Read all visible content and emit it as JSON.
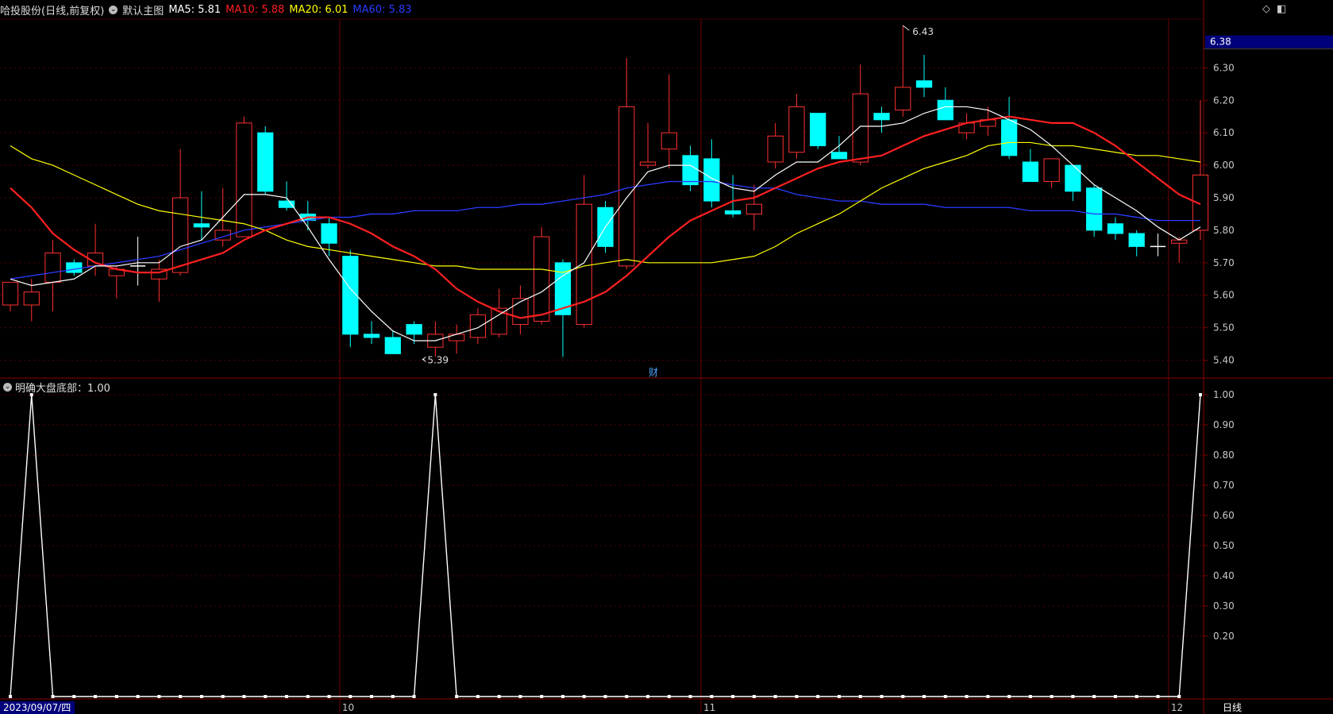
{
  "header": {
    "stock": "哈投股份",
    "mode": "(日线,前复权)",
    "template_label": "默认主图",
    "ma": [
      {
        "label": "MA5: 5.81",
        "color": "#ffffff"
      },
      {
        "label": "MA10: 5.88",
        "color": "#ff2020"
      },
      {
        "label": "MA20: 6.01",
        "color": "#ffff00"
      },
      {
        "label": "MA60: 5.83",
        "color": "#2a3bff"
      }
    ]
  },
  "sub": {
    "label": "明确大盘底部：1.00"
  },
  "price_tag": "6.38",
  "max_label": "6.43",
  "min_label": "5.39",
  "fin_marker": "财",
  "period_label": "日线",
  "date_label": "2023/09/07/四",
  "month_labels": [
    "10",
    "11",
    "12"
  ],
  "chart_data": {
    "type": "candlestick",
    "y_range": [
      5.35,
      6.45
    ],
    "y_ticks": [
      "6.30",
      "6.20",
      "6.10",
      "6.00",
      "5.90",
      "5.80",
      "5.70",
      "5.60",
      "5.50",
      "5.40"
    ],
    "sub_ticks": [
      "1.00",
      "0.90",
      "0.80",
      "0.70",
      "0.60",
      "0.50",
      "0.40",
      "0.30",
      "0.20"
    ],
    "sub_range": [
      0,
      1
    ],
    "month_starts": [
      16,
      33,
      55
    ],
    "candles": [
      {
        "o": 5.57,
        "h": 5.62,
        "l": 5.55,
        "c": 5.64,
        "d": "up"
      },
      {
        "o": 5.57,
        "h": 5.65,
        "l": 5.52,
        "c": 5.61,
        "d": "up"
      },
      {
        "o": 5.64,
        "h": 5.77,
        "l": 5.55,
        "c": 5.73,
        "d": "up"
      },
      {
        "o": 5.7,
        "h": 5.71,
        "l": 5.66,
        "c": 5.67,
        "d": "down"
      },
      {
        "o": 5.69,
        "h": 5.82,
        "l": 5.66,
        "c": 5.73,
        "d": "up"
      },
      {
        "o": 5.66,
        "h": 5.69,
        "l": 5.59,
        "c": 5.68,
        "d": "up"
      },
      {
        "o": 5.69,
        "h": 5.78,
        "l": 5.63,
        "c": 5.69,
        "d": "flat"
      },
      {
        "o": 5.65,
        "h": 5.71,
        "l": 5.58,
        "c": 5.68,
        "d": "up"
      },
      {
        "o": 5.67,
        "h": 6.05,
        "l": 5.66,
        "c": 5.9,
        "d": "up"
      },
      {
        "o": 5.82,
        "h": 5.92,
        "l": 5.77,
        "c": 5.81,
        "d": "down"
      },
      {
        "o": 5.77,
        "h": 5.93,
        "l": 5.75,
        "c": 5.8,
        "d": "up"
      },
      {
        "o": 5.78,
        "h": 6.15,
        "l": 5.78,
        "c": 6.13,
        "d": "up"
      },
      {
        "o": 6.1,
        "h": 6.12,
        "l": 5.91,
        "c": 5.92,
        "d": "down"
      },
      {
        "o": 5.89,
        "h": 5.95,
        "l": 5.86,
        "c": 5.87,
        "d": "down"
      },
      {
        "o": 5.85,
        "h": 5.89,
        "l": 5.8,
        "c": 5.83,
        "d": "down"
      },
      {
        "o": 5.82,
        "h": 5.84,
        "l": 5.72,
        "c": 5.76,
        "d": "down"
      },
      {
        "o": 5.72,
        "h": 5.74,
        "l": 5.44,
        "c": 5.48,
        "d": "down"
      },
      {
        "o": 5.48,
        "h": 5.52,
        "l": 5.45,
        "c": 5.47,
        "d": "down"
      },
      {
        "o": 5.47,
        "h": 5.49,
        "l": 5.42,
        "c": 5.42,
        "d": "down"
      },
      {
        "o": 5.51,
        "h": 5.52,
        "l": 5.45,
        "c": 5.48,
        "d": "down"
      },
      {
        "o": 5.44,
        "h": 5.52,
        "l": 5.41,
        "c": 5.48,
        "d": "up"
      },
      {
        "o": 5.46,
        "h": 5.51,
        "l": 5.42,
        "c": 5.48,
        "d": "up"
      },
      {
        "o": 5.47,
        "h": 5.56,
        "l": 5.45,
        "c": 5.54,
        "d": "up"
      },
      {
        "o": 5.48,
        "h": 5.62,
        "l": 5.47,
        "c": 5.56,
        "d": "up"
      },
      {
        "o": 5.51,
        "h": 5.63,
        "l": 5.48,
        "c": 5.59,
        "d": "up"
      },
      {
        "o": 5.52,
        "h": 5.81,
        "l": 5.51,
        "c": 5.78,
        "d": "up"
      },
      {
        "o": 5.7,
        "h": 5.71,
        "l": 5.41,
        "c": 5.54,
        "d": "down"
      },
      {
        "o": 5.51,
        "h": 5.97,
        "l": 5.5,
        "c": 5.88,
        "d": "up"
      },
      {
        "o": 5.87,
        "h": 5.89,
        "l": 5.73,
        "c": 5.75,
        "d": "down"
      },
      {
        "o": 5.69,
        "h": 6.33,
        "l": 5.68,
        "c": 6.18,
        "d": "up"
      },
      {
        "o": 6.0,
        "h": 6.13,
        "l": 5.99,
        "c": 6.01,
        "d": "up"
      },
      {
        "o": 6.05,
        "h": 6.28,
        "l": 5.99,
        "c": 6.1,
        "d": "up"
      },
      {
        "o": 6.03,
        "h": 6.06,
        "l": 5.92,
        "c": 5.94,
        "d": "down"
      },
      {
        "o": 6.02,
        "h": 6.08,
        "l": 5.87,
        "c": 5.89,
        "d": "down"
      },
      {
        "o": 5.86,
        "h": 5.97,
        "l": 5.84,
        "c": 5.85,
        "d": "down"
      },
      {
        "o": 5.85,
        "h": 5.94,
        "l": 5.8,
        "c": 5.88,
        "d": "up"
      },
      {
        "o": 6.01,
        "h": 6.13,
        "l": 5.99,
        "c": 6.09,
        "d": "up"
      },
      {
        "o": 6.04,
        "h": 6.22,
        "l": 6.02,
        "c": 6.18,
        "d": "up"
      },
      {
        "o": 6.16,
        "h": 6.16,
        "l": 6.05,
        "c": 6.06,
        "d": "down"
      },
      {
        "o": 6.04,
        "h": 6.09,
        "l": 6.02,
        "c": 6.02,
        "d": "down"
      },
      {
        "o": 6.01,
        "h": 6.31,
        "l": 6.0,
        "c": 6.22,
        "d": "up"
      },
      {
        "o": 6.16,
        "h": 6.18,
        "l": 6.1,
        "c": 6.14,
        "d": "down"
      },
      {
        "o": 6.17,
        "h": 6.43,
        "l": 6.15,
        "c": 6.24,
        "d": "up"
      },
      {
        "o": 6.26,
        "h": 6.34,
        "l": 6.21,
        "c": 6.24,
        "d": "down"
      },
      {
        "o": 6.2,
        "h": 6.24,
        "l": 6.15,
        "c": 6.14,
        "d": "down"
      },
      {
        "o": 6.13,
        "h": 6.16,
        "l": 6.08,
        "c": 6.1,
        "d": "up"
      },
      {
        "o": 6.14,
        "h": 6.18,
        "l": 6.09,
        "c": 6.12,
        "d": "up"
      },
      {
        "o": 6.14,
        "h": 6.21,
        "l": 6.02,
        "c": 6.03,
        "d": "down"
      },
      {
        "o": 6.01,
        "h": 6.05,
        "l": 5.95,
        "c": 5.95,
        "d": "down"
      },
      {
        "o": 5.95,
        "h": 6.02,
        "l": 5.93,
        "c": 6.02,
        "d": "up"
      },
      {
        "o": 6.0,
        "h": 6.0,
        "l": 5.89,
        "c": 5.92,
        "d": "down"
      },
      {
        "o": 5.93,
        "h": 5.94,
        "l": 5.78,
        "c": 5.8,
        "d": "down"
      },
      {
        "o": 5.82,
        "h": 5.84,
        "l": 5.77,
        "c": 5.79,
        "d": "down"
      },
      {
        "o": 5.79,
        "h": 5.8,
        "l": 5.72,
        "c": 5.75,
        "d": "down"
      },
      {
        "o": 5.75,
        "h": 5.79,
        "l": 5.72,
        "c": 5.75,
        "d": "flat"
      },
      {
        "o": 5.76,
        "h": 5.78,
        "l": 5.7,
        "c": 5.77,
        "d": "up"
      },
      {
        "o": 5.8,
        "h": 6.2,
        "l": 5.77,
        "c": 5.97,
        "d": "up"
      }
    ],
    "ma5": [
      5.65,
      5.63,
      5.64,
      5.65,
      5.69,
      5.69,
      5.7,
      5.7,
      5.75,
      5.77,
      5.84,
      5.91,
      5.91,
      5.9,
      5.81,
      5.71,
      5.62,
      5.55,
      5.49,
      5.46,
      5.46,
      5.48,
      5.5,
      5.54,
      5.58,
      5.61,
      5.66,
      5.7,
      5.81,
      5.9,
      5.98,
      6.0,
      6.0,
      5.96,
      5.93,
      5.92,
      5.97,
      6.01,
      6.01,
      6.06,
      6.12,
      6.12,
      6.13,
      6.16,
      6.18,
      6.18,
      6.17,
      6.14,
      6.11,
      6.06,
      6.0,
      5.94,
      5.9,
      5.86,
      5.81,
      5.77,
      5.81
    ],
    "ma10": [
      5.93,
      5.87,
      5.79,
      5.74,
      5.7,
      5.68,
      5.67,
      5.67,
      5.69,
      5.71,
      5.73,
      5.77,
      5.8,
      5.82,
      5.84,
      5.84,
      5.82,
      5.79,
      5.75,
      5.72,
      5.68,
      5.62,
      5.58,
      5.55,
      5.53,
      5.54,
      5.56,
      5.58,
      5.61,
      5.66,
      5.72,
      5.78,
      5.83,
      5.86,
      5.89,
      5.9,
      5.93,
      5.96,
      5.99,
      6.01,
      6.02,
      6.03,
      6.06,
      6.09,
      6.11,
      6.13,
      6.14,
      6.15,
      6.14,
      6.13,
      6.13,
      6.1,
      6.06,
      6.01,
      5.96,
      5.91,
      5.88
    ],
    "ma20": [
      6.06,
      6.02,
      6.0,
      5.97,
      5.94,
      5.91,
      5.88,
      5.86,
      5.85,
      5.84,
      5.83,
      5.82,
      5.8,
      5.77,
      5.75,
      5.74,
      5.73,
      5.72,
      5.71,
      5.7,
      5.69,
      5.69,
      5.68,
      5.68,
      5.68,
      5.68,
      5.67,
      5.69,
      5.7,
      5.71,
      5.7,
      5.7,
      5.7,
      5.7,
      5.71,
      5.72,
      5.75,
      5.79,
      5.82,
      5.85,
      5.89,
      5.93,
      5.96,
      5.99,
      6.01,
      6.03,
      6.06,
      6.07,
      6.07,
      6.06,
      6.06,
      6.05,
      6.04,
      6.03,
      6.03,
      6.02,
      6.01
    ],
    "ma60": [
      5.65,
      5.66,
      5.67,
      5.68,
      5.69,
      5.7,
      5.71,
      5.72,
      5.74,
      5.76,
      5.78,
      5.8,
      5.81,
      5.82,
      5.83,
      5.84,
      5.84,
      5.85,
      5.85,
      5.86,
      5.86,
      5.86,
      5.87,
      5.87,
      5.88,
      5.88,
      5.89,
      5.9,
      5.91,
      5.93,
      5.94,
      5.95,
      5.95,
      5.95,
      5.94,
      5.93,
      5.93,
      5.91,
      5.9,
      5.89,
      5.89,
      5.88,
      5.88,
      5.88,
      5.87,
      5.87,
      5.87,
      5.87,
      5.86,
      5.86,
      5.86,
      5.85,
      5.85,
      5.84,
      5.83,
      5.83,
      5.83
    ],
    "indicator": [
      0,
      1,
      0,
      0,
      0,
      0,
      0,
      0,
      0,
      0,
      0,
      0,
      0,
      0,
      0,
      0,
      0,
      0,
      0,
      0,
      1,
      0,
      0,
      0,
      0,
      0,
      0,
      0,
      0,
      0,
      0,
      0,
      0,
      0,
      0,
      0,
      0,
      0,
      0,
      0,
      0,
      0,
      0,
      0,
      0,
      0,
      0,
      0,
      0,
      0,
      0,
      0,
      0,
      0,
      0,
      0,
      1
    ]
  }
}
